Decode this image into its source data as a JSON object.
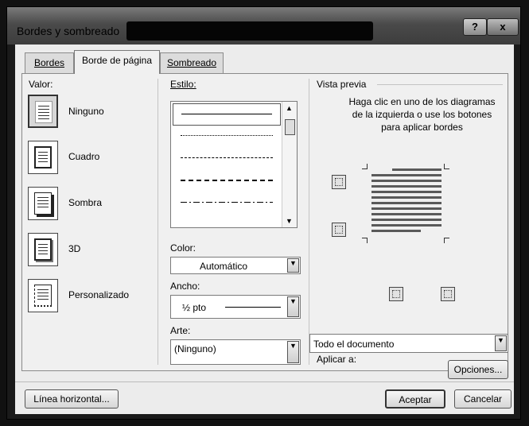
{
  "window": {
    "title": "Bordes y sombreado",
    "help_label": "?",
    "close_label": "x"
  },
  "tabs": [
    {
      "label": "Bordes"
    },
    {
      "label": "Borde de página"
    },
    {
      "label": "Sombreado"
    }
  ],
  "settings": {
    "heading": "Valor:",
    "items": [
      {
        "label": "Ninguno"
      },
      {
        "label": "Cuadro"
      },
      {
        "label": "Sombra"
      },
      {
        "label": "3D"
      },
      {
        "label": "Personalizado"
      }
    ],
    "selected": "Ninguno"
  },
  "style": {
    "heading": "Estilo:",
    "items": [
      "solid",
      "dotted",
      "dashed",
      "dash-large",
      "dash-dot"
    ],
    "selected": "solid"
  },
  "color": {
    "label": "Color:",
    "value": "Automático"
  },
  "width": {
    "label": "Ancho:",
    "value": "½ pto"
  },
  "art": {
    "label": "Arte:",
    "value": "(Ninguno)"
  },
  "preview": {
    "heading": "Vista previa",
    "instructions": "Haga clic en uno de los diagramas de la izquierda o use los botones para aplicar bordes"
  },
  "apply_to": {
    "label": "Aplicar a:",
    "value": "Todo el documento"
  },
  "buttons": {
    "options": "Opciones...",
    "horizontal_line": "Línea horizontal...",
    "ok": "Aceptar",
    "cancel": "Cancelar"
  }
}
